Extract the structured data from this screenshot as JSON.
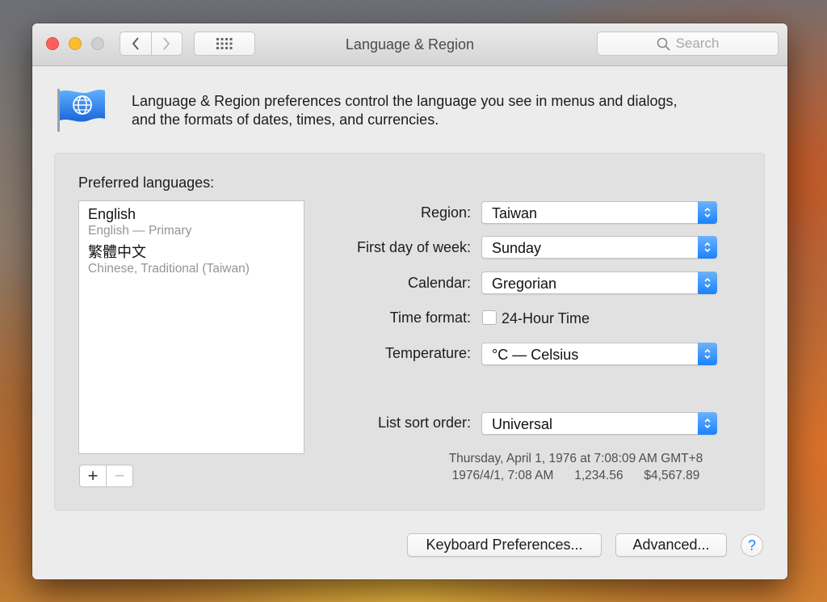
{
  "window": {
    "title": "Language & Region",
    "search_placeholder": "Search"
  },
  "intro": {
    "line1": "Language & Region preferences control the language you see in menus and dialogs,",
    "line2": "and the formats of dates, times, and currencies."
  },
  "languages": {
    "label": "Preferred languages:",
    "items": [
      {
        "name": "English",
        "detail": "English — Primary"
      },
      {
        "name": "繁體中文",
        "detail": "Chinese, Traditional (Taiwan)"
      }
    ],
    "add_label": "+",
    "remove_label": "−"
  },
  "settings": {
    "region": {
      "label": "Region:",
      "value": "Taiwan"
    },
    "first_day": {
      "label": "First day of week:",
      "value": "Sunday"
    },
    "calendar": {
      "label": "Calendar:",
      "value": "Gregorian"
    },
    "time_format": {
      "label": "Time format:",
      "checkbox_label": "24-Hour Time",
      "checked": false
    },
    "temperature": {
      "label": "Temperature:",
      "value": "°C — Celsius"
    },
    "sort_order": {
      "label": "List sort order:",
      "value": "Universal"
    }
  },
  "sample": {
    "line1": "Thursday, April 1, 1976 at 7:08:09 AM GMT+8",
    "line2": "1976/4/1, 7:08 AM      1,234.56      $4,567.89"
  },
  "buttons": {
    "keyboard": "Keyboard Preferences...",
    "advanced": "Advanced...",
    "help": "?"
  },
  "colors": {
    "accent": "#1a82fb",
    "close": "#fc5f57",
    "minimize": "#fdbc2e"
  }
}
